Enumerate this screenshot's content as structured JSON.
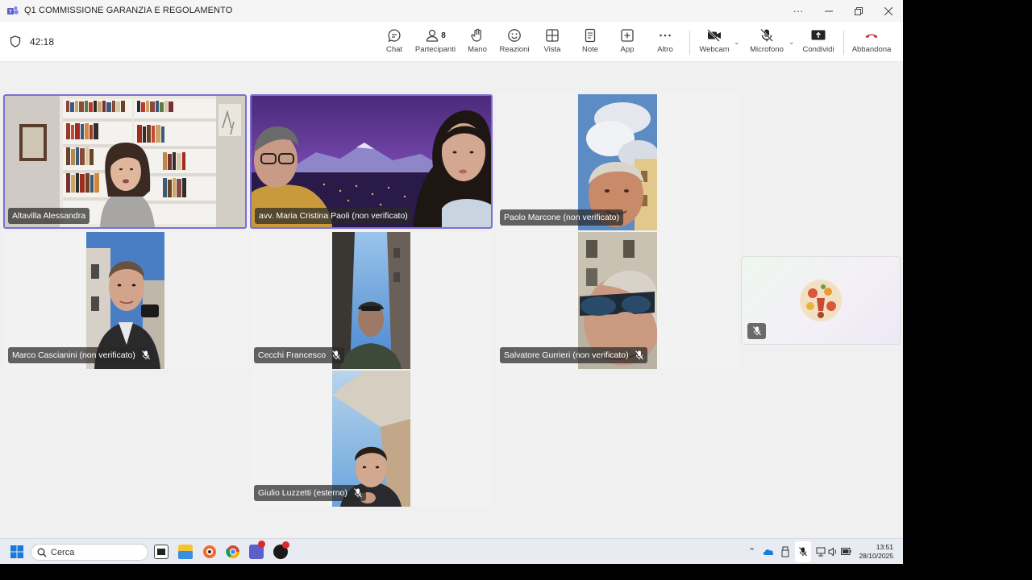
{
  "window": {
    "title": "Q1 COMMISSIONE GARANZIA E REGOLAMENTO"
  },
  "toolbar": {
    "timer": "42:18",
    "chat": "Chat",
    "participants": "Partecipanti",
    "participants_count": "8",
    "hand": "Mano",
    "reactions": "Reazioni",
    "view": "Vista",
    "notes": "Note",
    "apps": "App",
    "more": "Altro",
    "webcam": "Webcam",
    "microphone": "Microfono",
    "share": "Condividi",
    "leave": "Abbandona"
  },
  "participants": [
    {
      "name": "Altavilla Alessandra",
      "muted": false,
      "speaking": true
    },
    {
      "name": "avv. Maria Cristina Paoli (non verificato)",
      "muted": false,
      "speaking": true
    },
    {
      "name": "Paolo Marcone (non verificato)",
      "muted": false,
      "speaking": false
    },
    {
      "name": "Marco Cascianini (non verificato)",
      "muted": true,
      "speaking": false
    },
    {
      "name": "Cecchi Francesco",
      "muted": true,
      "speaking": false
    },
    {
      "name": "Salvatore Gurrieri (non verificato)",
      "muted": true,
      "speaking": false
    },
    {
      "name": "Giulio Luzzetti (esterno)",
      "muted": true,
      "speaking": false
    }
  ],
  "self_view": {
    "muted": true
  },
  "taskbar": {
    "search_placeholder": "Cerca",
    "time": "13:51",
    "date": "28/10/2025"
  },
  "colors": {
    "active_speaker_border": "#7b6fd6",
    "leave_red": "#c4314b",
    "teams_purple": "#5b5fc7"
  }
}
